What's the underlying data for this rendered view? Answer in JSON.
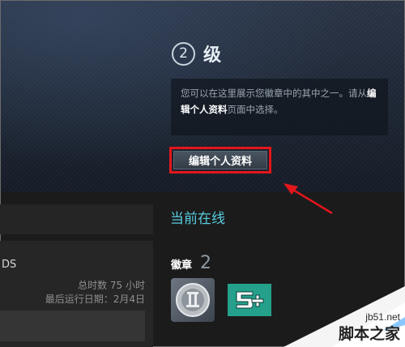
{
  "profile": {
    "level_number": "2",
    "level_label": "级",
    "badge_text_line1": "您可以在这里展示您徽章中的其中之一。请从",
    "badge_text_link": "编辑个人资料",
    "badge_text_line2": "页面中选择。",
    "edit_button_label": "编辑个人资料"
  },
  "game": {
    "name": "DS",
    "total_hours": "总时数 75 小时",
    "last_played": "最后运行日期：2月4日"
  },
  "sidebar": {
    "status": "当前在线",
    "badges_label": "徽章",
    "badges_count": "2",
    "badge_icons": [
      "pillar-badge-icon",
      "5-plus-badge-icon"
    ]
  },
  "watermark": {
    "site": "jb51.net",
    "name": "脚本之家"
  },
  "colors": {
    "status": "#57cbde",
    "highlight_border": "#e3161c",
    "badge_teal": "#24a08b"
  }
}
